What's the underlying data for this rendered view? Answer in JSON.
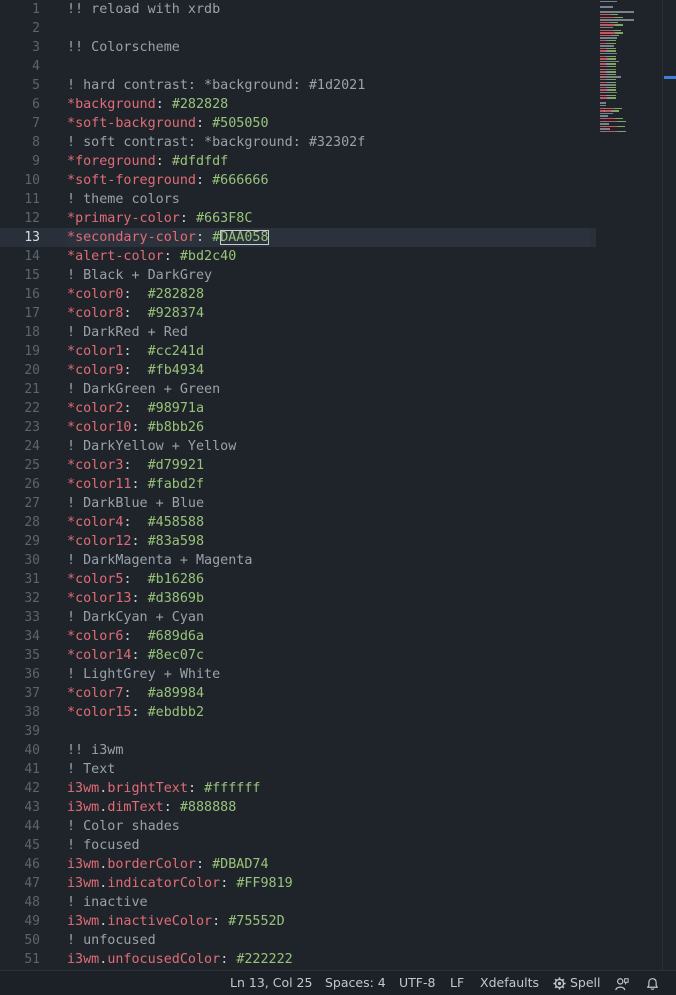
{
  "editor": {
    "current_line": 13,
    "lines": [
      {
        "n": "1",
        "tokens": [
          {
            "t": "comment",
            "v": "!! reload with xrdb"
          }
        ]
      },
      {
        "n": "2",
        "tokens": []
      },
      {
        "n": "3",
        "tokens": [
          {
            "t": "comment",
            "v": "!! Colorscheme"
          }
        ]
      },
      {
        "n": "4",
        "tokens": []
      },
      {
        "n": "5",
        "tokens": [
          {
            "t": "comment",
            "v": "! hard contrast: *background: #1d2021"
          }
        ]
      },
      {
        "n": "6",
        "tokens": [
          {
            "t": "star",
            "v": "*"
          },
          {
            "t": "key",
            "v": "background"
          },
          {
            "t": "punct",
            "v": ": "
          },
          {
            "t": "val",
            "v": "#282828"
          }
        ]
      },
      {
        "n": "7",
        "tokens": [
          {
            "t": "star",
            "v": "*"
          },
          {
            "t": "key",
            "v": "soft-background"
          },
          {
            "t": "punct",
            "v": ": "
          },
          {
            "t": "val",
            "v": "#505050"
          }
        ]
      },
      {
        "n": "8",
        "tokens": [
          {
            "t": "comment",
            "v": "! soft contrast: *background: #32302f"
          }
        ]
      },
      {
        "n": "9",
        "tokens": [
          {
            "t": "star",
            "v": "*"
          },
          {
            "t": "key",
            "v": "foreground"
          },
          {
            "t": "punct",
            "v": ": "
          },
          {
            "t": "val",
            "v": "#dfdfdf"
          }
        ]
      },
      {
        "n": "10",
        "tokens": [
          {
            "t": "star",
            "v": "*"
          },
          {
            "t": "key",
            "v": "soft-foreground"
          },
          {
            "t": "punct",
            "v": ": "
          },
          {
            "t": "val",
            "v": "#666666"
          }
        ]
      },
      {
        "n": "11",
        "tokens": [
          {
            "t": "comment",
            "v": "! theme colors"
          }
        ]
      },
      {
        "n": "12",
        "tokens": [
          {
            "t": "star",
            "v": "*"
          },
          {
            "t": "key",
            "v": "primary-color"
          },
          {
            "t": "punct",
            "v": ": "
          },
          {
            "t": "val",
            "v": "#663F8C"
          }
        ]
      },
      {
        "n": "13",
        "tokens": [
          {
            "t": "star",
            "v": "*"
          },
          {
            "t": "key",
            "v": "secondary-color"
          },
          {
            "t": "punct",
            "v": ": "
          },
          {
            "t": "val",
            "v": "#"
          },
          {
            "t": "sel",
            "v": "DAA058"
          }
        ]
      },
      {
        "n": "14",
        "tokens": [
          {
            "t": "star",
            "v": "*"
          },
          {
            "t": "key",
            "v": "alert-color"
          },
          {
            "t": "punct",
            "v": ": "
          },
          {
            "t": "val",
            "v": "#bd2c40"
          }
        ]
      },
      {
        "n": "15",
        "tokens": [
          {
            "t": "comment",
            "v": "! Black + DarkGrey"
          }
        ]
      },
      {
        "n": "16",
        "tokens": [
          {
            "t": "star",
            "v": "*"
          },
          {
            "t": "key",
            "v": "color0"
          },
          {
            "t": "punct",
            "v": ":  "
          },
          {
            "t": "val",
            "v": "#282828"
          }
        ]
      },
      {
        "n": "17",
        "tokens": [
          {
            "t": "star",
            "v": "*"
          },
          {
            "t": "key",
            "v": "color8"
          },
          {
            "t": "punct",
            "v": ":  "
          },
          {
            "t": "val",
            "v": "#928374"
          }
        ]
      },
      {
        "n": "18",
        "tokens": [
          {
            "t": "comment",
            "v": "! DarkRed + Red"
          }
        ]
      },
      {
        "n": "19",
        "tokens": [
          {
            "t": "star",
            "v": "*"
          },
          {
            "t": "key",
            "v": "color1"
          },
          {
            "t": "punct",
            "v": ":  "
          },
          {
            "t": "val",
            "v": "#cc241d"
          }
        ]
      },
      {
        "n": "20",
        "tokens": [
          {
            "t": "star",
            "v": "*"
          },
          {
            "t": "key",
            "v": "color9"
          },
          {
            "t": "punct",
            "v": ":  "
          },
          {
            "t": "val",
            "v": "#fb4934"
          }
        ]
      },
      {
        "n": "21",
        "tokens": [
          {
            "t": "comment",
            "v": "! DarkGreen + Green"
          }
        ]
      },
      {
        "n": "22",
        "tokens": [
          {
            "t": "star",
            "v": "*"
          },
          {
            "t": "key",
            "v": "color2"
          },
          {
            "t": "punct",
            "v": ":  "
          },
          {
            "t": "val",
            "v": "#98971a"
          }
        ]
      },
      {
        "n": "23",
        "tokens": [
          {
            "t": "star",
            "v": "*"
          },
          {
            "t": "key",
            "v": "color10"
          },
          {
            "t": "punct",
            "v": ": "
          },
          {
            "t": "val",
            "v": "#b8bb26"
          }
        ]
      },
      {
        "n": "24",
        "tokens": [
          {
            "t": "comment",
            "v": "! DarkYellow + Yellow"
          }
        ]
      },
      {
        "n": "25",
        "tokens": [
          {
            "t": "star",
            "v": "*"
          },
          {
            "t": "key",
            "v": "color3"
          },
          {
            "t": "punct",
            "v": ":  "
          },
          {
            "t": "val",
            "v": "#d79921"
          }
        ]
      },
      {
        "n": "26",
        "tokens": [
          {
            "t": "star",
            "v": "*"
          },
          {
            "t": "key",
            "v": "color11"
          },
          {
            "t": "punct",
            "v": ": "
          },
          {
            "t": "val",
            "v": "#fabd2f"
          }
        ]
      },
      {
        "n": "27",
        "tokens": [
          {
            "t": "comment",
            "v": "! DarkBlue + Blue"
          }
        ]
      },
      {
        "n": "28",
        "tokens": [
          {
            "t": "star",
            "v": "*"
          },
          {
            "t": "key",
            "v": "color4"
          },
          {
            "t": "punct",
            "v": ":  "
          },
          {
            "t": "val",
            "v": "#458588"
          }
        ]
      },
      {
        "n": "29",
        "tokens": [
          {
            "t": "star",
            "v": "*"
          },
          {
            "t": "key",
            "v": "color12"
          },
          {
            "t": "punct",
            "v": ": "
          },
          {
            "t": "val",
            "v": "#83a598"
          }
        ]
      },
      {
        "n": "30",
        "tokens": [
          {
            "t": "comment",
            "v": "! DarkMagenta + Magenta"
          }
        ]
      },
      {
        "n": "31",
        "tokens": [
          {
            "t": "star",
            "v": "*"
          },
          {
            "t": "key",
            "v": "color5"
          },
          {
            "t": "punct",
            "v": ":  "
          },
          {
            "t": "val",
            "v": "#b16286"
          }
        ]
      },
      {
        "n": "32",
        "tokens": [
          {
            "t": "star",
            "v": "*"
          },
          {
            "t": "key",
            "v": "color13"
          },
          {
            "t": "punct",
            "v": ": "
          },
          {
            "t": "val",
            "v": "#d3869b"
          }
        ]
      },
      {
        "n": "33",
        "tokens": [
          {
            "t": "comment",
            "v": "! DarkCyan + Cyan"
          }
        ]
      },
      {
        "n": "34",
        "tokens": [
          {
            "t": "star",
            "v": "*"
          },
          {
            "t": "key",
            "v": "color6"
          },
          {
            "t": "punct",
            "v": ":  "
          },
          {
            "t": "val",
            "v": "#689d6a"
          }
        ]
      },
      {
        "n": "35",
        "tokens": [
          {
            "t": "star",
            "v": "*"
          },
          {
            "t": "key",
            "v": "color14"
          },
          {
            "t": "punct",
            "v": ": "
          },
          {
            "t": "val",
            "v": "#8ec07c"
          }
        ]
      },
      {
        "n": "36",
        "tokens": [
          {
            "t": "comment",
            "v": "! LightGrey + White"
          }
        ]
      },
      {
        "n": "37",
        "tokens": [
          {
            "t": "star",
            "v": "*"
          },
          {
            "t": "key",
            "v": "color7"
          },
          {
            "t": "punct",
            "v": ":  "
          },
          {
            "t": "val",
            "v": "#a89984"
          }
        ]
      },
      {
        "n": "38",
        "tokens": [
          {
            "t": "star",
            "v": "*"
          },
          {
            "t": "key",
            "v": "color15"
          },
          {
            "t": "punct",
            "v": ": "
          },
          {
            "t": "val",
            "v": "#ebdbb2"
          }
        ]
      },
      {
        "n": "39",
        "tokens": []
      },
      {
        "n": "40",
        "tokens": [
          {
            "t": "comment",
            "v": "!! i3wm"
          }
        ]
      },
      {
        "n": "41",
        "tokens": [
          {
            "t": "comment",
            "v": "! Text"
          }
        ]
      },
      {
        "n": "42",
        "tokens": [
          {
            "t": "key",
            "v": "i3wm"
          },
          {
            "t": "punct",
            "v": "."
          },
          {
            "t": "key",
            "v": "brightText"
          },
          {
            "t": "punct",
            "v": ": "
          },
          {
            "t": "val",
            "v": "#ffffff"
          }
        ]
      },
      {
        "n": "43",
        "tokens": [
          {
            "t": "key",
            "v": "i3wm"
          },
          {
            "t": "punct",
            "v": "."
          },
          {
            "t": "key",
            "v": "dimText"
          },
          {
            "t": "punct",
            "v": ": "
          },
          {
            "t": "val",
            "v": "#888888"
          }
        ]
      },
      {
        "n": "44",
        "tokens": [
          {
            "t": "comment",
            "v": "! Color shades"
          }
        ]
      },
      {
        "n": "45",
        "tokens": [
          {
            "t": "comment",
            "v": "! focused"
          }
        ]
      },
      {
        "n": "46",
        "tokens": [
          {
            "t": "key",
            "v": "i3wm"
          },
          {
            "t": "punct",
            "v": "."
          },
          {
            "t": "key",
            "v": "borderColor"
          },
          {
            "t": "punct",
            "v": ": "
          },
          {
            "t": "val",
            "v": "#DBAD74"
          }
        ]
      },
      {
        "n": "47",
        "tokens": [
          {
            "t": "key",
            "v": "i3wm"
          },
          {
            "t": "punct",
            "v": "."
          },
          {
            "t": "key",
            "v": "indicatorColor"
          },
          {
            "t": "punct",
            "v": ": "
          },
          {
            "t": "val",
            "v": "#FF9819"
          }
        ]
      },
      {
        "n": "48",
        "tokens": [
          {
            "t": "comment",
            "v": "! inactive"
          }
        ]
      },
      {
        "n": "49",
        "tokens": [
          {
            "t": "key",
            "v": "i3wm"
          },
          {
            "t": "punct",
            "v": "."
          },
          {
            "t": "key",
            "v": "inactiveColor"
          },
          {
            "t": "punct",
            "v": ": "
          },
          {
            "t": "val",
            "v": "#75552D"
          }
        ]
      },
      {
        "n": "50",
        "tokens": [
          {
            "t": "comment",
            "v": "! unfocused"
          }
        ]
      },
      {
        "n": "51",
        "tokens": [
          {
            "t": "key",
            "v": "i3wm"
          },
          {
            "t": "punct",
            "v": "."
          },
          {
            "t": "key",
            "v": "unfocusedColor"
          },
          {
            "t": "punct",
            "v": ": "
          },
          {
            "t": "val",
            "v": "#222222"
          }
        ]
      }
    ]
  },
  "statusbar": {
    "cursor_position": "Ln 13, Col 25",
    "indentation": "Spaces: 4",
    "encoding": "UTF-8",
    "line_ending": "LF",
    "language": "Xdefaults",
    "spell_label": "Spell",
    "icons": {
      "spell": "gear-icon",
      "feedback": "feedback-icon",
      "notifications": "bell-icon"
    }
  },
  "colors": {
    "background": "#1f242b",
    "comment": "#9aa1a9",
    "key": "#e06c75",
    "value": "#98c379",
    "current_line": "#2a3039",
    "scroll_accent": "#3f7fd9"
  }
}
